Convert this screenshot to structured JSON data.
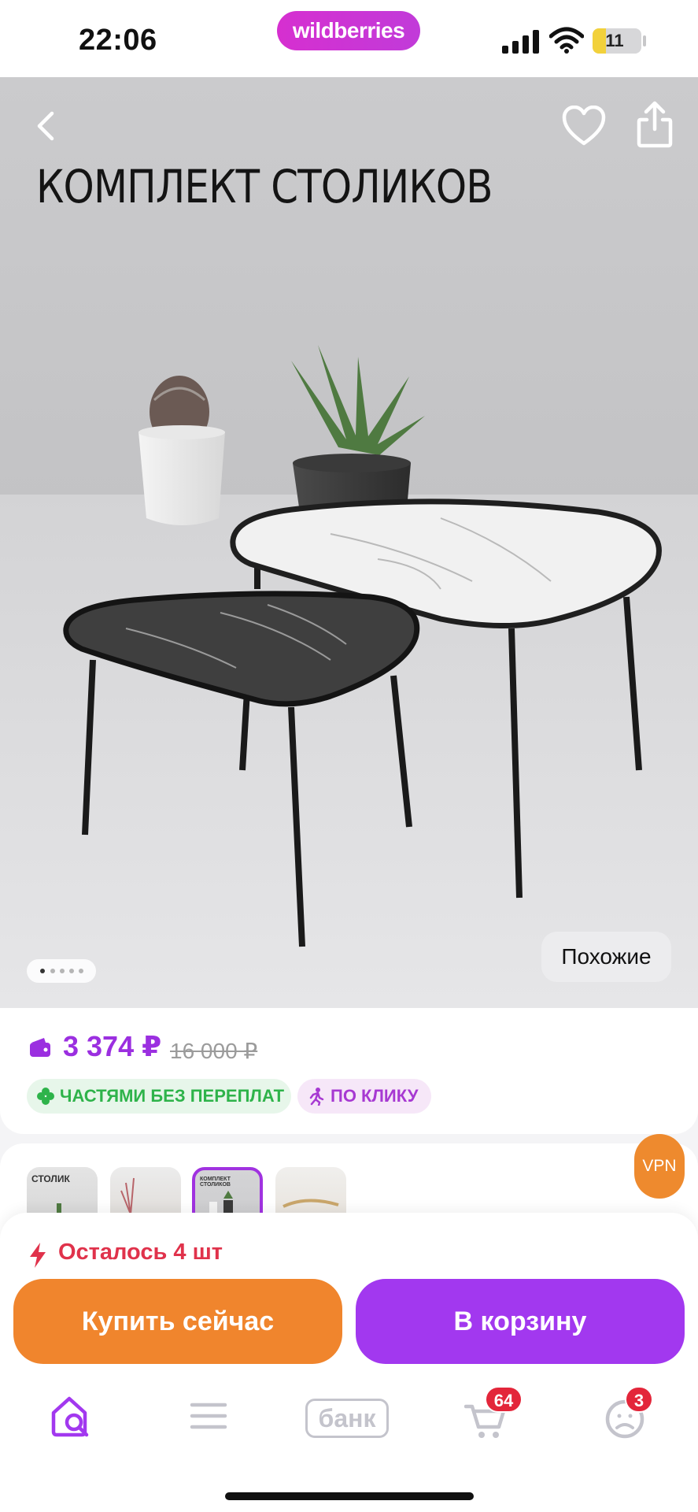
{
  "status_bar": {
    "time": "22:06",
    "brand_pill": "wildberries",
    "battery_level": "11",
    "battery_fraction": 0.11
  },
  "product_image": {
    "title_text": "КОМПЛЕКТ СТОЛИКОВ",
    "back_icon": "chevron-left-icon",
    "favorite_icon": "heart-icon",
    "share_icon": "share-icon",
    "carousel_pages": 5,
    "carousel_active_page": 1,
    "similar_label": "Похожие"
  },
  "price": {
    "current": "3 374 ₽",
    "old": "16 000 ₽",
    "wallet_icon": "wallet-icon",
    "accent_color": "#9b2fe0",
    "badges": [
      {
        "label": "ЧАСТЯМИ БЕЗ ПЕРЕПЛАТ",
        "icon": "clover-icon",
        "color": "#2eb34a"
      },
      {
        "label": "ПО КЛИКУ",
        "icon": "running-person-icon",
        "color": "#a739d2"
      }
    ]
  },
  "gallery": {
    "thumbnails": [
      {
        "caption": "СТОЛИК"
      },
      {
        "caption": ""
      },
      {
        "caption": "КОМПЛЕКТ СТОЛИКОВ",
        "active": true
      },
      {
        "caption": ""
      }
    ]
  },
  "vpn_badge": "VPN",
  "purchase": {
    "stock_text": "Осталось 4 шт",
    "stock_icon": "lightning-icon",
    "buy_now_label": "Купить сейчас",
    "add_to_cart_label": "В корзину",
    "buy_now_color": "#f0852d",
    "cart_color": "#a238ef"
  },
  "tab_bar": {
    "home_icon": "home-search-icon",
    "menu_icon": "menu-icon",
    "bank_label": "банк",
    "cart_icon": "cart-icon",
    "cart_count": "64",
    "profile_icon": "profile-icon",
    "profile_count": "3"
  }
}
